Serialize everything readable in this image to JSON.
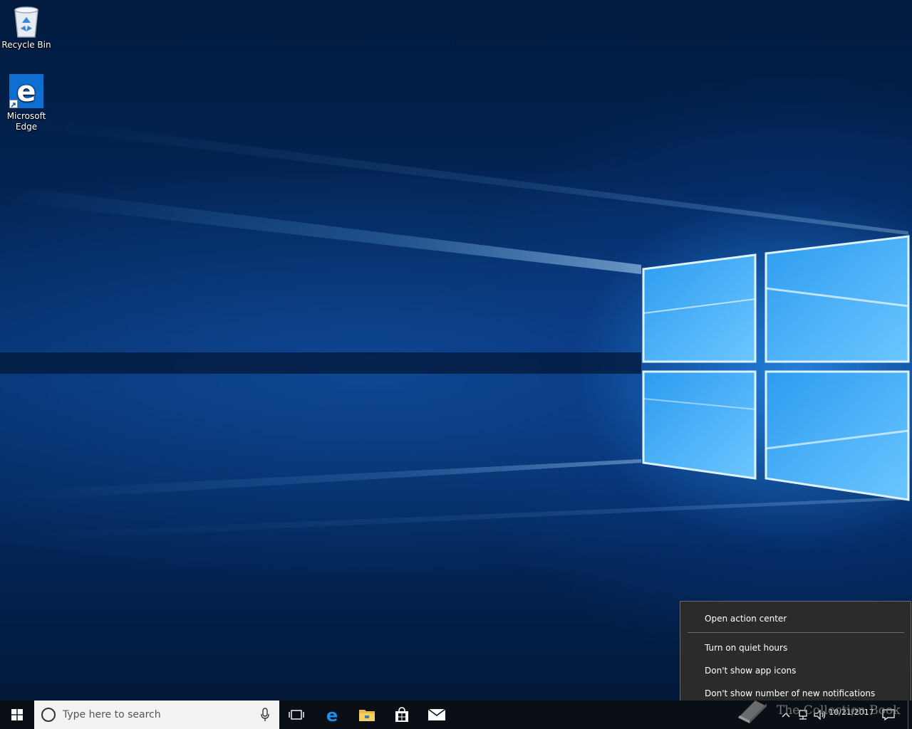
{
  "desktop": {
    "icons": [
      {
        "label": "Recycle Bin",
        "icon": "recycle-bin-icon"
      },
      {
        "label": "Microsoft\nEdge",
        "icon": "edge-icon"
      }
    ]
  },
  "taskbar": {
    "search": {
      "placeholder": "Type here to search"
    },
    "pinned": [
      "start-icon",
      "cortana-icon",
      "mic-icon",
      "task-view-icon",
      "edge-icon",
      "file-explorer-icon",
      "store-icon",
      "mail-icon"
    ],
    "clock": {
      "time": "",
      "date": "10/21/2017"
    }
  },
  "context_menu": {
    "items": [
      "Open action center",
      "Turn on quiet hours",
      "Don't show app icons",
      "Don't show number of new notifications"
    ]
  },
  "watermark": {
    "text": "The Collection Book"
  },
  "colors": {
    "taskbar": "#0a0f16",
    "menu_bg": "#2b2b2b",
    "menu_border": "#6a6a6a",
    "accent": "#0f6fd1"
  }
}
